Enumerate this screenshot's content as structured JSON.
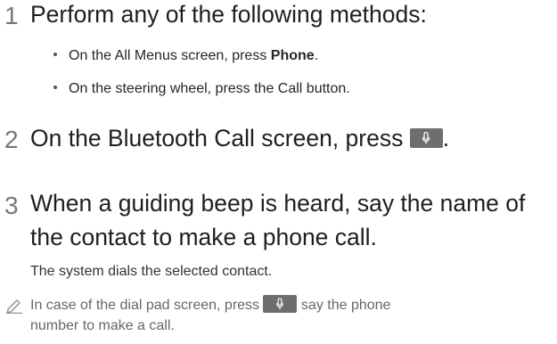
{
  "steps": [
    {
      "number": "1",
      "text": "Perform any of the following methods:",
      "bullets": [
        {
          "prefix": "On the All Menus screen, press ",
          "bold": "Phone",
          "suffix": "."
        },
        {
          "text": "On the steering wheel, press the Call button."
        }
      ]
    },
    {
      "number": "2",
      "prefix": "On the Bluetooth Call screen, press ",
      "suffix": ".",
      "icon": "microphone-icon"
    },
    {
      "number": "3",
      "line1": "When a guiding beep is heard, say the name of",
      "line2": "the contact to make a phone call.",
      "result": "The system dials the selected contact."
    }
  ],
  "note": {
    "icon": "pencil-icon",
    "prefix": "In case of the dial pad screen, press ",
    "suffix": " say the phone",
    "line2": "number to make a call."
  },
  "colors": {
    "button_bg": "#6e6e6e",
    "step_number": "#777777",
    "note_text": "#666666"
  }
}
